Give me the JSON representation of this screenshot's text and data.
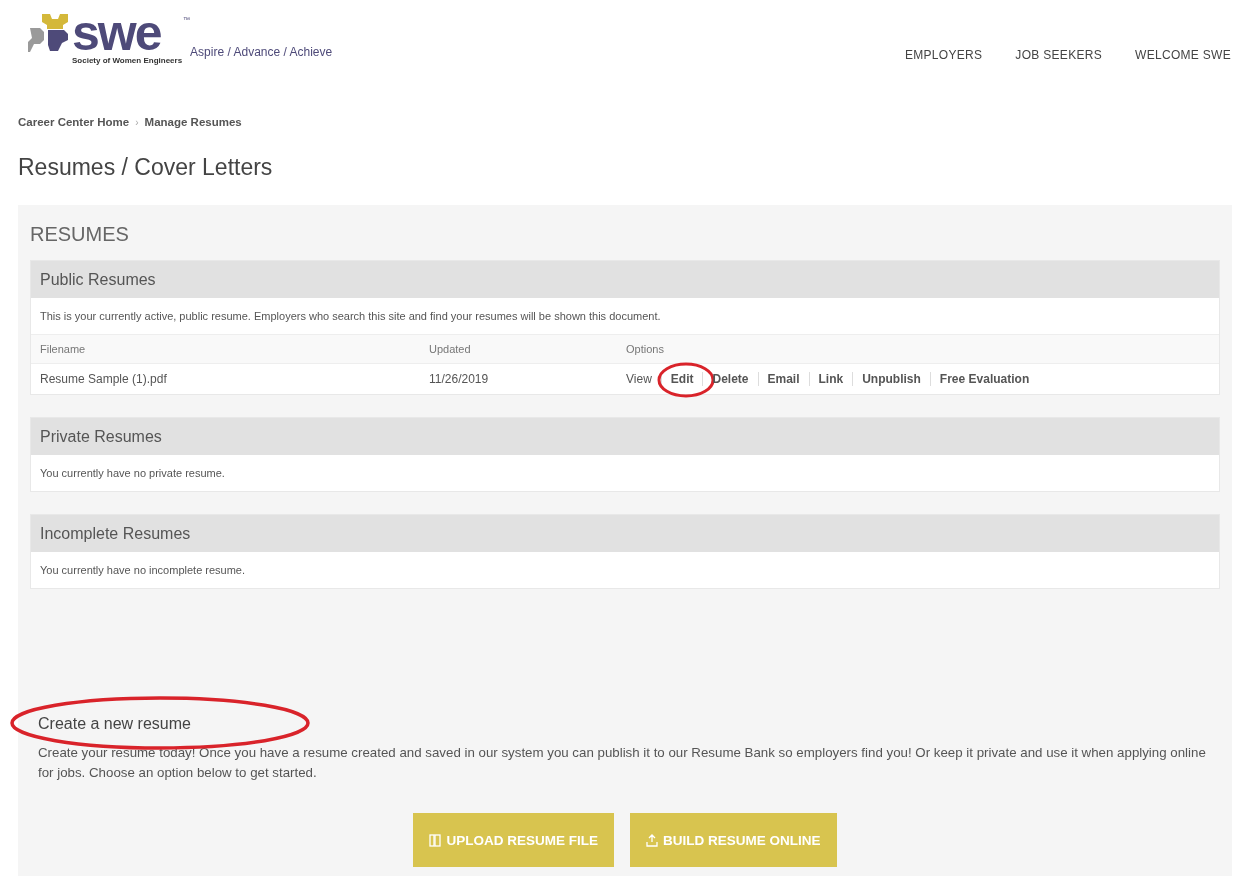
{
  "logo": {
    "wordmark": "swe",
    "trademark": "™",
    "subtitle": "Society of Women Engineers",
    "tagline": "Aspire / Advance / Achieve"
  },
  "nav": [
    {
      "label": "EMPLOYERS"
    },
    {
      "label": "JOB SEEKERS"
    },
    {
      "label": "WELCOME SWE"
    }
  ],
  "breadcrumb": [
    {
      "label": "Career Center Home"
    },
    {
      "label": "Manage Resumes"
    }
  ],
  "breadcrumb_separator": "›",
  "page_title": "Resumes / Cover Letters",
  "panel_title": "RESUMES",
  "sections": [
    {
      "title": "Public Resumes",
      "kind": "table",
      "note": "This is your currently active, public resume. Employers who search this site and find your resumes will be shown this document.",
      "columns": [
        "Filename",
        "Updated",
        "Options"
      ],
      "rows": [
        {
          "filename": "Resume Sample (1).pdf",
          "updated": "11/26/2019",
          "options": [
            {
              "label": "View",
              "circled": false
            },
            {
              "label": "Edit",
              "circled": true
            },
            {
              "label": "Delete",
              "circled": false
            },
            {
              "label": "Email",
              "circled": false
            },
            {
              "label": "Link",
              "circled": false
            },
            {
              "label": "Unpublish",
              "circled": false
            },
            {
              "label": "Free Evaluation",
              "circled": false
            }
          ]
        }
      ]
    },
    {
      "title": "Private Resumes",
      "kind": "message",
      "note": "You currently have no private resume."
    },
    {
      "title": "Incomplete Resumes",
      "kind": "message",
      "note": "You currently have no incomplete resume."
    }
  ],
  "create": {
    "heading": "Create a new resume",
    "circled": true,
    "text": "Create your resume today! Once you have a resume created and saved in our system you can publish it to our Resume Bank so employers find you! Or keep it private and use it when applying online for jobs. Choose an option below to get started.",
    "buttons": [
      {
        "label": "UPLOAD RESUME FILE",
        "kind": "upload"
      },
      {
        "label": "BUILD RESUME ONLINE",
        "kind": "build"
      }
    ]
  }
}
